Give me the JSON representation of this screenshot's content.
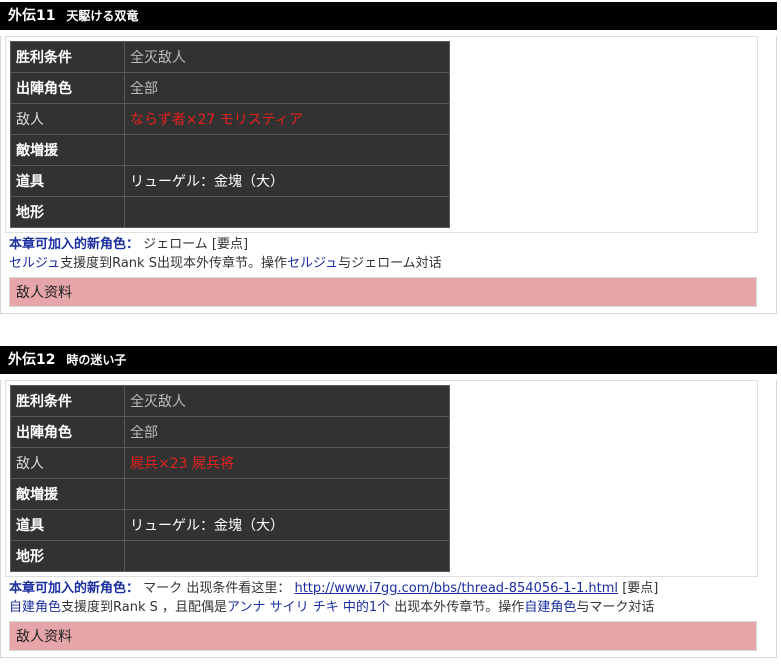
{
  "chapters": [
    {
      "num": "外伝11",
      "title": "天駆ける双竜",
      "rows": [
        {
          "key": "胜利条件",
          "value": ""
        },
        {
          "key": "出陣角色",
          "value": "全部"
        },
        {
          "key": "敌人",
          "value": "ならず者×27 モリスティア"
        },
        {
          "key": "敵増援",
          "value": ""
        },
        {
          "key": "道具",
          "value": "リューゲル：金塊（大）"
        },
        {
          "key": "地形",
          "value": ""
        }
      ],
      "victory_value": "全灭敌人",
      "new_char_label": "本章可加入的新角色：",
      "new_char_name": "ジェローム",
      "key_point": "[要点]",
      "cond_part1": "セルジュ",
      "cond_part2": "支援度到Rank S出现本外传章节。操作",
      "cond_part3": "セルジュ",
      "cond_part4": "与ジェローム対话",
      "enemy_info": "敌人资料"
    },
    {
      "num": "外伝12",
      "title": "時の迷い子",
      "rows": [
        {
          "key": "胜利条件",
          "value": "全灭敌人"
        },
        {
          "key": "出陣角色",
          "value": "全部"
        },
        {
          "key": "敌人",
          "value": "屍兵×23 屍兵将"
        },
        {
          "key": "敵増援",
          "value": ""
        },
        {
          "key": "道具",
          "value": "リューゲル：金塊（大）"
        },
        {
          "key": "地形",
          "value": ""
        }
      ],
      "new_char_label": "本章可加入的新角色：",
      "new_char_name": "マーク",
      "appear_text": "出现条件看这里：",
      "url": "http://www.i7gg.com/bbs/thread-854056-1-1.html",
      "key_point": "[要点]",
      "cond_part1": "自建角色",
      "cond_part2": "支援度到Rank S ，且配偶是",
      "cond_part3": "アンナ サイリ  チキ 中的1个",
      "cond_part4": " 出现本外传章节。操作",
      "cond_part5": "自建角色",
      "cond_part6": "与マーク対话",
      "enemy_info": "敌人资料"
    }
  ]
}
